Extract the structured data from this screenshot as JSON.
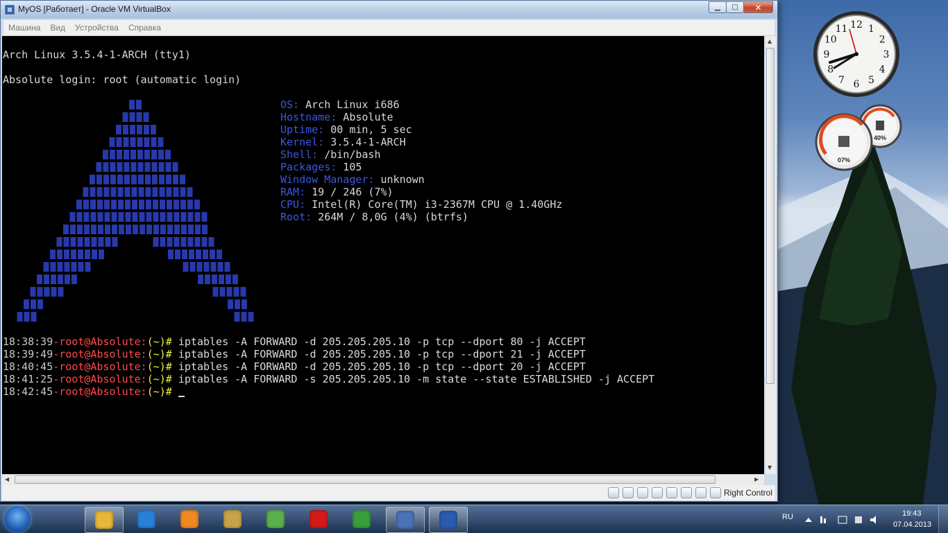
{
  "window": {
    "title": "MyOS [Работает] - Oracle VM VirtualBox",
    "close_label": "✕"
  },
  "menu": [
    "Машина",
    "Вид",
    "Устройства",
    "Справка"
  ],
  "terminal": {
    "banner": "Arch Linux 3.5.4-1-ARCH (tty1)",
    "login": "Absolute login: root (automatic login)",
    "info": [
      {
        "key": "OS:",
        "value": " Arch Linux i686"
      },
      {
        "key": "Hostname:",
        "value": " Absolute"
      },
      {
        "key": "Uptime:",
        "value": " 00 min, 5 sec"
      },
      {
        "key": "Kernel:",
        "value": " 3.5.4-1-ARCH"
      },
      {
        "key": "Shell:",
        "value": " /bin/bash"
      },
      {
        "key": "Packages:",
        "value": " 105"
      },
      {
        "key": "Window Manager:",
        "value": " unknown"
      },
      {
        "key": "RAM:",
        "value": " 19 / 246 (7%)"
      },
      {
        "key": "CPU:",
        "value": " Intel(R) Core(TM) i3-2367M CPU @ 1.40GHz"
      },
      {
        "key": "Root:",
        "value": " 264M / 8,0G (4%) (btrfs)"
      }
    ],
    "prompt_user": "-root@Absolute:",
    "prompt_path": "(~)#",
    "commands": [
      {
        "time": "18:38:39",
        "cmd": " iptables -A FORWARD -d 205.205.205.10 -p tcp --dport 80 -j ACCEPT"
      },
      {
        "time": "18:39:49",
        "cmd": " iptables -A FORWARD -d 205.205.205.10 -p tcp --dport 21 -j ACCEPT"
      },
      {
        "time": "18:40:45",
        "cmd": " iptables -A FORWARD -d 205.205.205.10 -p tcp --dport 20 -j ACCEPT"
      },
      {
        "time": "18:41:25",
        "cmd": " iptables -A FORWARD -s 205.205.205.10 -m state --state ESTABLISHED -j ACCEPT"
      },
      {
        "time": "18:42:45",
        "cmd": " "
      }
    ]
  },
  "statusbar": {
    "host_key": "Right Control"
  },
  "gadgets": {
    "clock_numbers": [
      "12",
      "1",
      "2",
      "3",
      "4",
      "5",
      "6",
      "7",
      "8",
      "9",
      "10",
      "11"
    ],
    "cpu_meter": "07%",
    "mem_meter": "40%"
  },
  "taskbar": {
    "apps": [
      "explorer-icon",
      "internet-explorer-icon",
      "media-player-icon",
      "paint-icon",
      "messenger-icon",
      "opera-icon",
      "chrome-icon",
      "virtualbox-icon",
      "word-icon"
    ],
    "language": "RU",
    "time": "19:43",
    "date": "07.04.2013"
  },
  "colors": {
    "terminal_bg": "#000000",
    "blue": "#3b57e0",
    "prompt_red": "#ff4a4a",
    "prompt_yellow": "#f0f040"
  }
}
